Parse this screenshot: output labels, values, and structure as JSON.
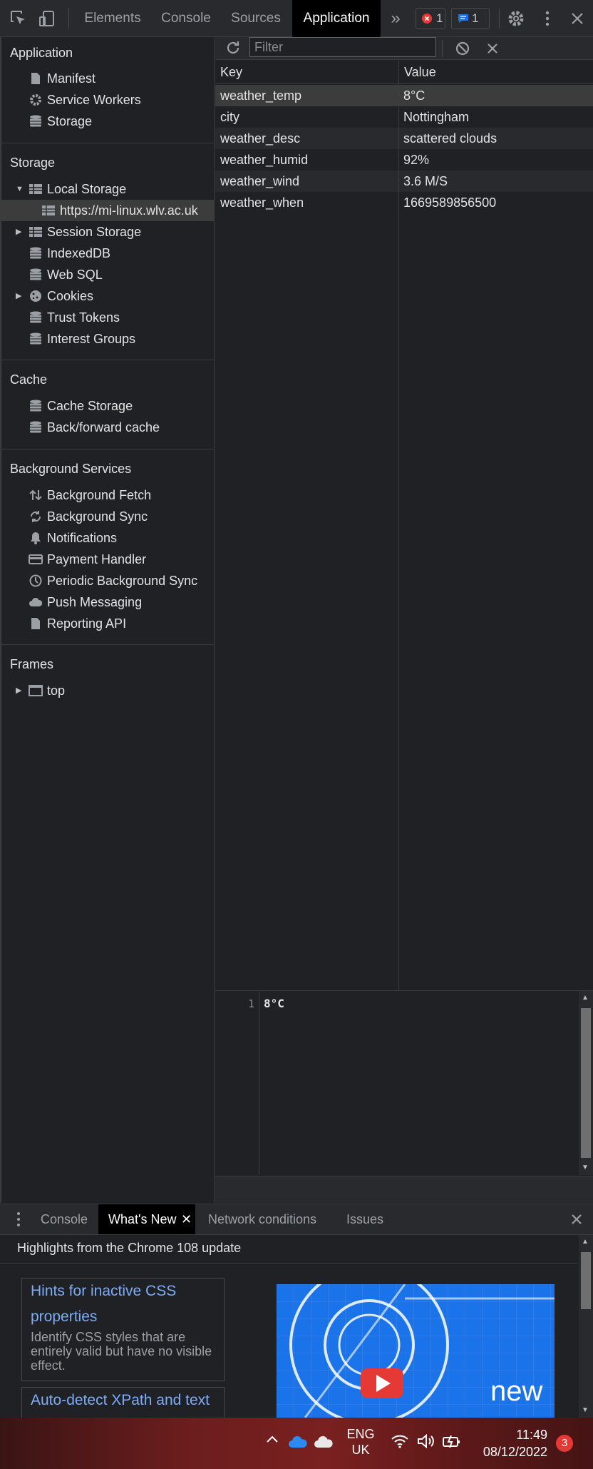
{
  "toolbar": {
    "tabs": [
      "Elements",
      "Console",
      "Sources",
      "Application"
    ],
    "more_label": "»",
    "errors_count": "1",
    "messages_count": "1"
  },
  "sidebar": {
    "application": {
      "title": "Application",
      "items": [
        "Manifest",
        "Service Workers",
        "Storage"
      ]
    },
    "storage": {
      "title": "Storage",
      "items": [
        "Local Storage",
        "https://mi-linux.wlv.ac.uk",
        "Session Storage",
        "IndexedDB",
        "Web SQL",
        "Cookies",
        "Trust Tokens",
        "Interest Groups"
      ]
    },
    "cache": {
      "title": "Cache",
      "items": [
        "Cache Storage",
        "Back/forward cache"
      ]
    },
    "background": {
      "title": "Background Services",
      "items": [
        "Background Fetch",
        "Background Sync",
        "Notifications",
        "Payment Handler",
        "Periodic Background Sync",
        "Push Messaging",
        "Reporting API"
      ]
    },
    "frames": {
      "title": "Frames",
      "items": [
        "top"
      ]
    }
  },
  "filter": {
    "placeholder": "Filter"
  },
  "table": {
    "headers": [
      "Key",
      "Value"
    ],
    "rows": [
      {
        "key": "weather_temp",
        "value": "8°C"
      },
      {
        "key": "city",
        "value": "Nottingham"
      },
      {
        "key": "weather_desc",
        "value": "scattered clouds"
      },
      {
        "key": "weather_humid",
        "value": "92%"
      },
      {
        "key": "weather_wind",
        "value": "3.6 M/S"
      },
      {
        "key": "weather_when",
        "value": "1669589856500"
      }
    ]
  },
  "preview": {
    "line_number": "1",
    "line_text": "8°C"
  },
  "drawer": {
    "tabs": [
      "Console",
      "What's New",
      "Network conditions",
      "Issues"
    ],
    "heading": "Highlights from the Chrome 108 update",
    "cards": [
      {
        "title": "Hints for inactive CSS properties",
        "desc": "Identify CSS styles that are entirely valid but have no visible effect."
      },
      {
        "title": "Auto-detect XPath and text",
        "desc": ""
      }
    ],
    "promo_text": "new"
  },
  "taskbar": {
    "lang_top": "ENG",
    "lang_bottom": "UK",
    "time": "11:49",
    "date": "08/12/2022",
    "notif_count": "3"
  },
  "colors": {
    "accent_link": "#7cacf8",
    "error": "#e53935",
    "info": "#1a73e8"
  }
}
